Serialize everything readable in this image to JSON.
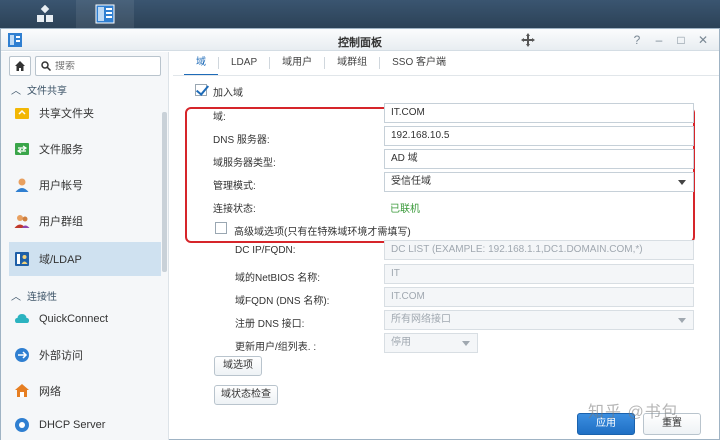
{
  "window": {
    "title": "控制面板"
  },
  "sidebar": {
    "search_placeholder": "搜索",
    "sections": [
      {
        "label": "文件共享"
      },
      {
        "label": "连接性"
      }
    ],
    "items": [
      {
        "label": "共享文件夹",
        "icon": "shared-folder-icon"
      },
      {
        "label": "文件服务",
        "icon": "file-service-icon"
      },
      {
        "label": "用户帐号",
        "icon": "user-icon"
      },
      {
        "label": "用户群组",
        "icon": "user-group-icon"
      },
      {
        "label": "域/LDAP",
        "icon": "domain-ldap-icon"
      },
      {
        "label": "QuickConnect",
        "icon": "quickconnect-icon"
      },
      {
        "label": "外部访问",
        "icon": "external-access-icon"
      },
      {
        "label": "网络",
        "icon": "network-icon"
      },
      {
        "label": "DHCP Server",
        "icon": "dhcp-icon"
      }
    ]
  },
  "tabs": [
    {
      "label": "域"
    },
    {
      "label": "LDAP"
    },
    {
      "label": "域用户"
    },
    {
      "label": "域群组"
    },
    {
      "label": "SSO 客户端"
    }
  ],
  "form": {
    "join_domain_label": "加入域",
    "domain_label": "域:",
    "domain_value": "IT.COM",
    "dns_label": "DNS 服务器:",
    "dns_value": "192.168.10.5",
    "server_type_label": "域服务器类型:",
    "server_type_value": "AD 域",
    "mgmt_mode_label": "管理模式:",
    "mgmt_mode_value": "受信任域",
    "conn_status_label": "连接状态:",
    "conn_status_value": "已联机",
    "advanced_label": "高级域选项(只有在特殊域环境才需填写)",
    "dcip_label": "DC IP/FQDN:",
    "dcip_placeholder": "DC LIST (EXAMPLE: 192.168.1.1,DC1.DOMAIN.COM,*)",
    "netbios_label": "域的NetBIOS 名称:",
    "netbios_value": "IT",
    "fqdn_label": "域FQDN (DNS 名称):",
    "fqdn_value": "IT.COM",
    "register_dns_label": "注册 DNS 接口:",
    "register_dns_value": "所有网络接口",
    "update_users_label": "更新用户/组列表. :",
    "update_users_value": "停用",
    "domain_options_button": "域选项",
    "domain_check_button": "域状态检查"
  },
  "footer": {
    "apply_button": "应用",
    "reset_button": "重置"
  },
  "watermark": "知乎 @书包",
  "colors": {
    "accent": "#1e6bb8",
    "highlight": "#d6252a",
    "online": "#3a9a3a"
  }
}
